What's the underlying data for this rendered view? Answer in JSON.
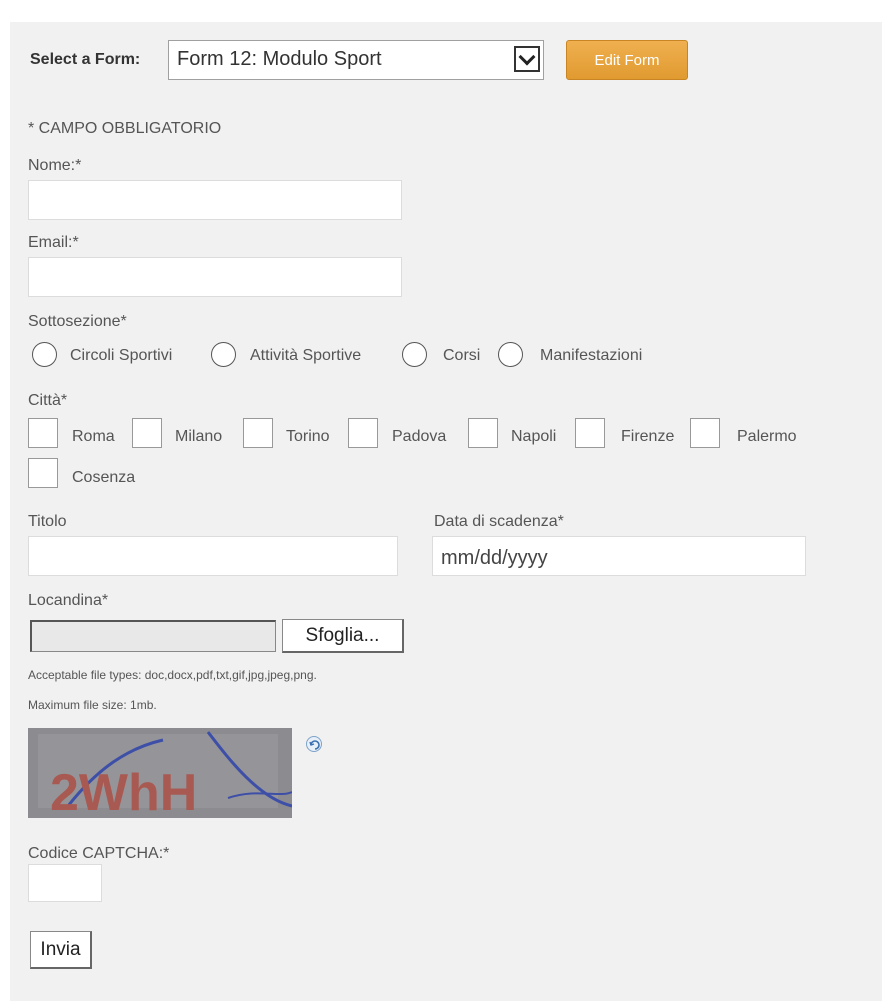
{
  "header": {
    "select_label": "Select a Form:",
    "selected_form": "Form 12: Modulo Sport",
    "edit_button": "Edit Form"
  },
  "form": {
    "required_note": "* CAMPO OBBLIGATORIO",
    "nome_label": "Nome:*",
    "email_label": "Email:*",
    "sottosezione_label": "Sottosezione*",
    "sottosezione_options": [
      "Circoli Sportivi",
      "Attività Sportive",
      "Corsi",
      "Manifestazioni"
    ],
    "citta_label": "Città*",
    "citta_options": [
      "Roma",
      "Milano",
      "Torino",
      "Padova",
      "Napoli",
      "Firenze",
      "Palermo",
      "Cosenza"
    ],
    "titolo_label": "Titolo",
    "data_label": "Data di scadenza*",
    "data_placeholder": "mm/dd/yyyy",
    "locandina_label": "Locandina*",
    "browse_button": "Sfoglia...",
    "file_types_note": "Acceptable file types: doc,docx,pdf,txt,gif,jpg,jpeg,png.",
    "max_size_note": "Maximum file size: 1mb.",
    "captcha_text": "2WhH",
    "captcha_label": "Codice CAPTCHA:*",
    "submit_button": "Invia"
  },
  "icons": {
    "select_arrow": "chevron-down-icon",
    "captcha_refresh": "refresh-icon"
  },
  "colors": {
    "panel_background": "#f1f1f1",
    "edit_button": "#e9a53b",
    "captcha_background": "#8c8c90"
  }
}
